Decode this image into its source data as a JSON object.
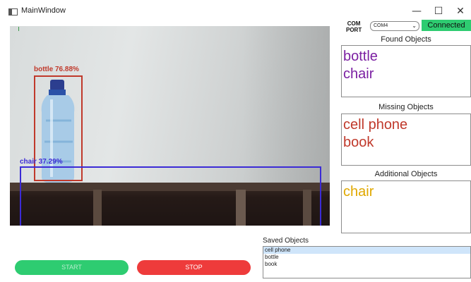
{
  "window": {
    "title": "MainWindow",
    "minimize": "—",
    "maximize": "☐",
    "close": "✕"
  },
  "detections": [
    {
      "label": "bottle 76.88%",
      "color": "#c0392b"
    },
    {
      "label": "chair 37.29%",
      "color": "#3b2bd6"
    }
  ],
  "com": {
    "label_line1": "COM",
    "label_line2": "PORT",
    "selected": "COM4",
    "arrow": "⌄",
    "status": "Connected"
  },
  "found": {
    "heading": "Found Objects",
    "items": [
      "bottle",
      "chair"
    ],
    "color": "#7b1fa2"
  },
  "missing": {
    "heading": "Missing Objects",
    "items": [
      "cell phone",
      "book"
    ],
    "color": "#c0392b"
  },
  "additional": {
    "heading": "Additional Objects",
    "items": [
      "chair"
    ],
    "color": "#e0a800"
  },
  "saved": {
    "heading": "Saved Objects",
    "items": [
      "cell phone",
      "bottle",
      "book"
    ]
  },
  "controls": {
    "start": "START",
    "stop": "STOP"
  }
}
